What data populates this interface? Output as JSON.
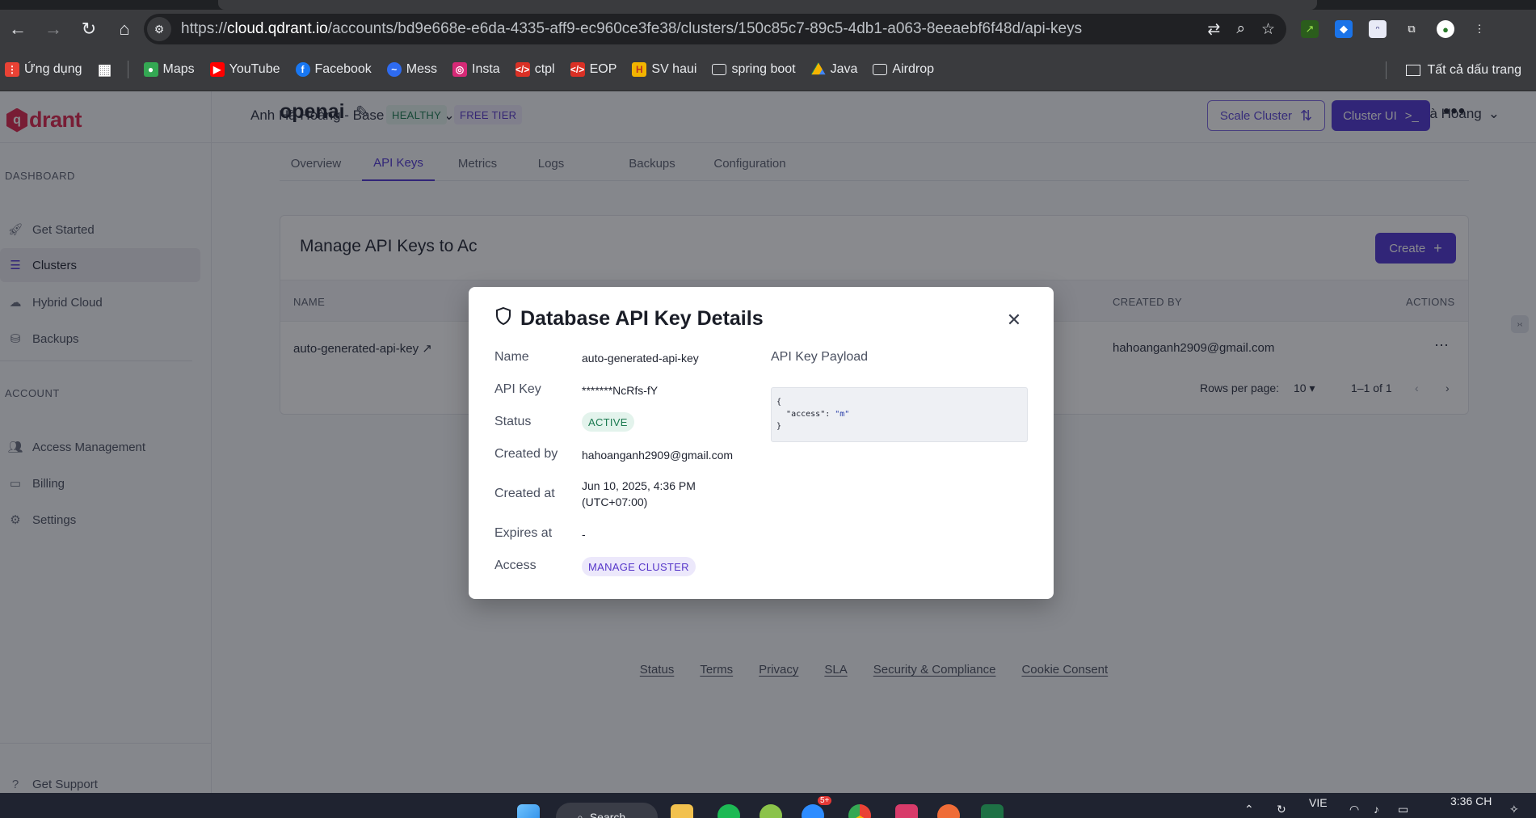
{
  "browser": {
    "url_prefix": "https://",
    "url_host": "cloud.qdrant.io",
    "url_path": "/accounts/bd9e668e-e6da-4335-aff9-ec960ce3fe38/clusters/150c85c7-89c5-4db1-a063-8eeaebf6f48d/api-keys",
    "bookmarks": [
      {
        "label": "Ứng dụng",
        "icon": "apps-grid-icon",
        "color": "#e94235"
      },
      {
        "label": "Maps",
        "icon": "maps-icon",
        "color": "#34a853"
      },
      {
        "label": "YouTube",
        "icon": "youtube-icon",
        "color": "#ff0000"
      },
      {
        "label": "Facebook",
        "icon": "facebook-icon",
        "color": "#1877f2"
      },
      {
        "label": "Mess",
        "icon": "messenger-icon",
        "color": "#2e6bf0"
      },
      {
        "label": "Insta",
        "icon": "instagram-icon",
        "color": "#d62976"
      },
      {
        "label": "ctpl",
        "icon": "code-icon",
        "color": "#d93025"
      },
      {
        "label": "EOP",
        "icon": "code-icon",
        "color": "#d93025"
      },
      {
        "label": "SV haui",
        "icon": "haui-icon",
        "color": "#f2b400"
      },
      {
        "label": "spring boot",
        "icon": "folder-icon",
        "color": "#3a3b3e"
      },
      {
        "label": "Java",
        "icon": "drive-icon",
        "color": "#0f9d58"
      },
      {
        "label": "Airdrop",
        "icon": "folder-icon",
        "color": "#3a3b3e"
      }
    ],
    "all_bookmarks": "Tất cả dấu trang"
  },
  "sidebar": {
    "logo": "drant",
    "section_dashboard": "DASHBOARD",
    "section_account": "ACCOUNT",
    "items": [
      {
        "label": "Get Started",
        "icon": "rocket-icon"
      },
      {
        "label": "Clusters",
        "icon": "server-icon"
      },
      {
        "label": "Hybrid Cloud",
        "icon": "cloud-icon"
      },
      {
        "label": "Backups",
        "icon": "database-icon"
      },
      {
        "label": "Access Management",
        "icon": "users-icon"
      },
      {
        "label": "Billing",
        "icon": "card-icon"
      },
      {
        "label": "Settings",
        "icon": "gear-icon"
      }
    ],
    "support": "Get Support"
  },
  "topbar": {
    "account": "Anh Hà Hoàng - Base Account",
    "user": "Anh Hà Hoàng"
  },
  "cluster": {
    "name": "openai",
    "health": "HEALTHY",
    "tier": "FREE TIER",
    "scale_button": "Scale Cluster",
    "ui_button": "Cluster UI",
    "tabs": [
      "Overview",
      "API Keys",
      "Metrics",
      "Logs",
      "Backups",
      "Configuration"
    ],
    "active_tab": "API Keys"
  },
  "api_keys": {
    "title": "Manage API Keys to Ac",
    "create_button": "Create",
    "columns": {
      "name": "NAME",
      "created_by": "CREATED BY",
      "actions": "ACTIONS"
    },
    "rows": [
      {
        "name": "auto-generated-api-key",
        "created_by": "hahoanganh2909@gmail.com"
      }
    ],
    "rows_per_page_label": "Rows per page:",
    "rows_per_page": "10",
    "range": "1–1 of 1"
  },
  "modal": {
    "title": "Database API Key Details",
    "labels": {
      "name": "Name",
      "api_key": "API Key",
      "status": "Status",
      "created_by": "Created by",
      "created_at": "Created at",
      "expires_at": "Expires at",
      "access": "Access"
    },
    "values": {
      "name": "auto-generated-api-key",
      "api_key": "*******NcRfs-fY",
      "status": "ACTIVE",
      "created_by": "hahoanganh2909@gmail.com",
      "created_at_line1": "Jun 10, 2025, 4:36 PM",
      "created_at_line2": "(UTC+07:00)",
      "expires_at": "-",
      "access": "MANAGE CLUSTER"
    },
    "payload_label": "API Key Payload",
    "payload_key": "\"access\"",
    "payload_value": "\"m\""
  },
  "footer": [
    "Status",
    "Terms",
    "Privacy",
    "SLA",
    "Security & Compliance",
    "Cookie Consent"
  ],
  "taskbar": {
    "search": "Search",
    "language": "VIE",
    "time": "3:36 CH",
    "badge": "5+"
  }
}
